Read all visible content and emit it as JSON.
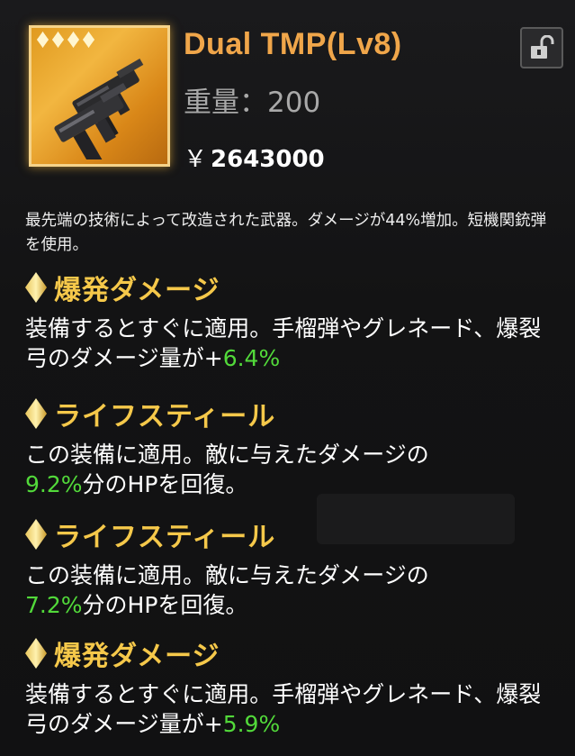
{
  "item": {
    "name": "Dual TMP(Lv8)",
    "weight": "重量：200",
    "currency_symbol": "￥",
    "price": "2643000",
    "rarity_stars": 4
  },
  "description": "最先端の技術によって改造された武器。ダメージが44%増加。短機関銃弾を使用。",
  "effects": [
    {
      "title": "爆発ダメージ",
      "body_prefix": "装備するとすぐに適用。手榴弾やグレネード、爆裂弓のダメージ量が+",
      "value": "6.4%",
      "body_suffix": ""
    },
    {
      "title": "ライフスティール",
      "body_prefix": "この装備に適用。敵に与えたダメージの",
      "value": "9.2%",
      "body_suffix": "分のHPを回復。"
    },
    {
      "title": "ライフスティール",
      "body_prefix": "この装備に適用。敵に与えたダメージの",
      "value": "7.2%",
      "body_suffix": "分のHPを回復。"
    },
    {
      "title": "爆発ダメージ",
      "body_prefix": "装備するとすぐに適用。手榴弾やグレネード、爆裂弓のダメージ量が+",
      "value": "5.9%",
      "body_suffix": ""
    }
  ],
  "colors": {
    "title": "#f0a64a",
    "section_title": "#f5c84a",
    "highlight_value": "#52d93a"
  },
  "icons": {
    "lock": "unlock-icon",
    "weapon": "submachine-gun-icon",
    "rarity": "diamond-star-icon"
  }
}
